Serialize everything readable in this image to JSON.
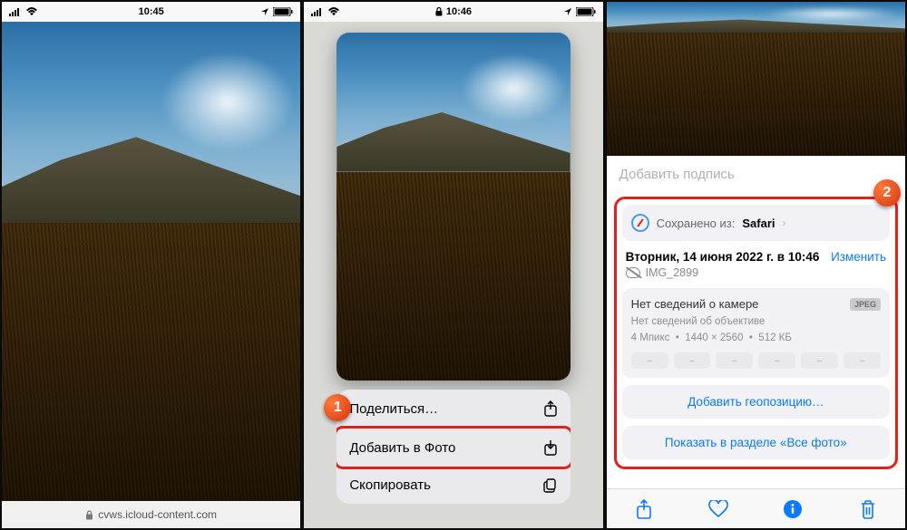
{
  "phone1": {
    "statusbar": {
      "time": "10:45"
    },
    "url": "cvws.icloud-content.com"
  },
  "phone2": {
    "statusbar": {
      "time": "10:46"
    },
    "menu": {
      "share": "Поделиться…",
      "add_to_photos": "Добавить в Фото",
      "copy": "Скопировать"
    },
    "badge": "1"
  },
  "phone3": {
    "caption_placeholder": "Добавить подпись",
    "saved_from_label": "Сохранено из:",
    "saved_from_app": "Safari",
    "date": "Вторник, 14 июня 2022 г. в 10:46",
    "filename": "IMG_2899",
    "edit": "Изменить",
    "no_camera": "Нет сведений о камере",
    "no_lens": "Нет сведений об объективе",
    "megapixels": "4 Мпикс",
    "dimensions": "1440 × 2560",
    "filesize": "512 КБ",
    "jpeg": "JPEG",
    "add_geo": "Добавить геопозицию…",
    "show_all": "Показать в разделе «Все фото»",
    "badge": "2"
  }
}
